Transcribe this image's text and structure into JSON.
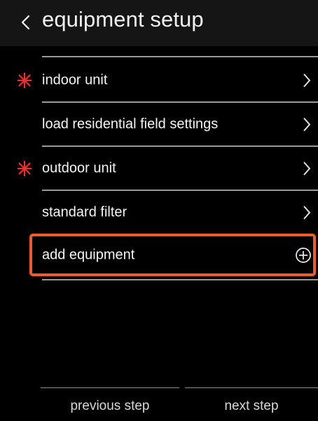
{
  "header": {
    "title": "equipment setup",
    "back_icon": "chevron-left-icon"
  },
  "equipment_rows": [
    {
      "label": "indoor unit",
      "required_icon": "asterisk-required-icon",
      "action_icon": "chevron-right-icon"
    },
    {
      "label": "load residential field settings",
      "action_icon": "chevron-right-icon"
    },
    {
      "label": "outdoor unit",
      "required_icon": "asterisk-required-icon",
      "action_icon": "chevron-right-icon"
    },
    {
      "label": "standard filter",
      "action_icon": "chevron-right-icon"
    }
  ],
  "add_equipment": {
    "label": "add equipment",
    "action_icon": "plus-circle-icon"
  },
  "footer": {
    "previous_label": "previous step",
    "next_label": "next step"
  },
  "colors": {
    "background": "#000000",
    "header_background": "#151515",
    "text": "#f5f5f5",
    "divider": "#9a9a9a",
    "required": "#ff2a2a",
    "highlight": "#f15a2b",
    "footer_text": "#d9d9d9"
  }
}
